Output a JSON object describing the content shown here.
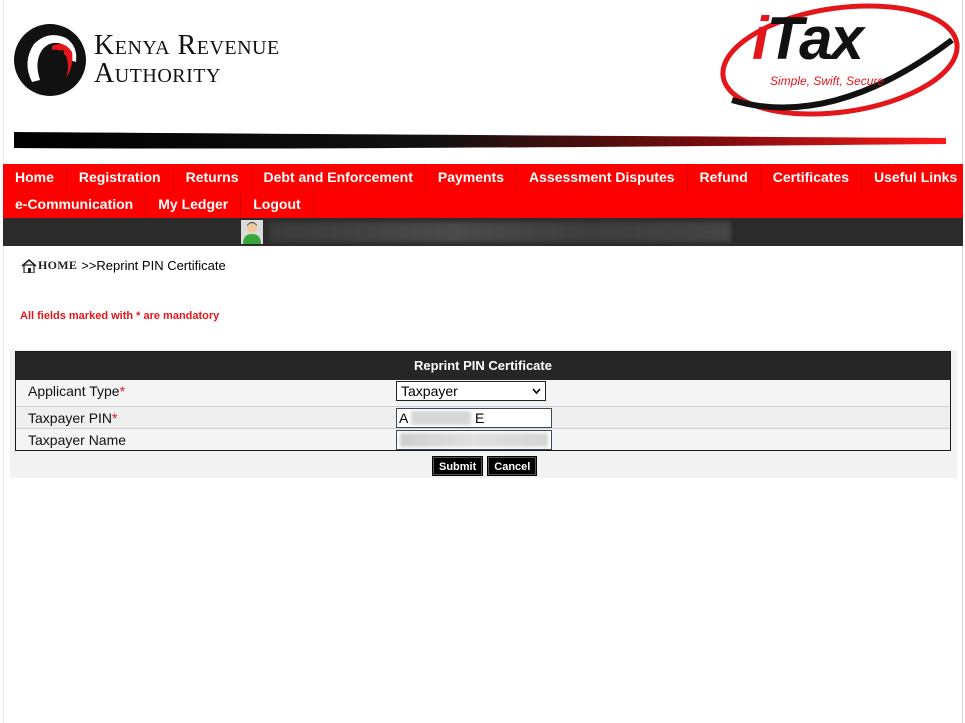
{
  "header": {
    "org_line1": "Kenya Revenue",
    "org_line2": "Authority",
    "brand_i": "i",
    "brand_word": "Tax",
    "tagline": "Simple, Swift, Secure"
  },
  "nav": {
    "row1": [
      "Home",
      "Registration",
      "Returns",
      "Debt and Enforcement",
      "Payments",
      "Assessment Disputes",
      "Refund",
      "Certificates",
      "Useful Links"
    ],
    "row2": [
      "e-Communication",
      "My Ledger",
      "Logout"
    ]
  },
  "breadcrumb": {
    "home": "HOME",
    "current": ">>Reprint PIN Certificate"
  },
  "mandatory_note": "All fields marked with * are mandatory",
  "form": {
    "title": "Reprint PIN Certificate",
    "applicant_type_label": "Applicant Type",
    "applicant_type_value": "Taxpayer",
    "taxpayer_pin_label": "Taxpayer PIN",
    "taxpayer_pin_start": "A",
    "taxpayer_pin_end": "E",
    "taxpayer_name_label": "Taxpayer Name",
    "required_mark": "*"
  },
  "buttons": {
    "submit": "Submit",
    "cancel": "Cancel"
  },
  "colors": {
    "brand_red": "#ff0000",
    "dark_bar": "#2b2b2b"
  }
}
